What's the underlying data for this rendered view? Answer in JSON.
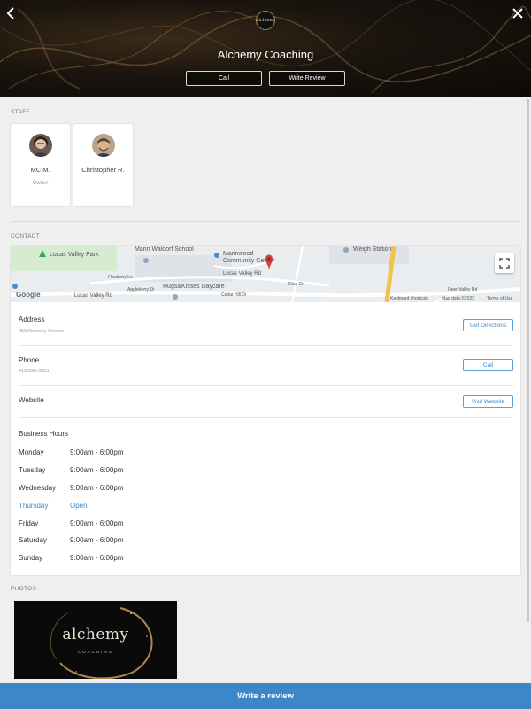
{
  "header": {
    "logo_text": "alchemy",
    "title": "Alchemy Coaching",
    "call_label": "Call",
    "review_label": "Write Review",
    "back_icon": "chevron-left-icon",
    "close_icon": "close-icon"
  },
  "staff": {
    "label": "STAFF",
    "members": [
      {
        "name": "MC M.",
        "role": "Owner"
      },
      {
        "name": "Christopher R.",
        "role": ""
      }
    ]
  },
  "contact": {
    "label": "CONTACT",
    "map": {
      "places": [
        "Lucas Valley Park",
        "Marin Waldorf School",
        "Marinwood Community Center",
        "Weigh Station",
        "Hugs&Kisses Daycare",
        "Lucas Valley Rd",
        "Lucas Valley Rd",
        "Flaxberry Ln",
        "Appleberry Dr",
        "Cedar Hill Dr",
        "Ellen Dr",
        "Deer Valley Rd"
      ],
      "attribution": [
        "Google",
        "Keyboard shortcuts",
        "Map data ©2022",
        "Terms of Use"
      ]
    },
    "address": {
      "title": "Address",
      "value": "950 Alchemy Avenue",
      "button": "Get Directions"
    },
    "phone": {
      "title": "Phone",
      "value": "413-896-3983",
      "button": "Call"
    },
    "website": {
      "title": "Website",
      "button": "Visit Website"
    },
    "hours": {
      "title": "Business Hours",
      "days": [
        {
          "day": "Monday",
          "time": "9:00am - 6:00pm"
        },
        {
          "day": "Tuesday",
          "time": "9:00am - 6:00pm"
        },
        {
          "day": "Wednesday",
          "time": "9:00am - 6:00pm"
        },
        {
          "day": "Thursday",
          "time": "Open"
        },
        {
          "day": "Friday",
          "time": "9:00am - 6:00pm"
        },
        {
          "day": "Saturday",
          "time": "9:00am - 6:00pm"
        },
        {
          "day": "Sunday",
          "time": "9:00am - 6:00pm"
        }
      ]
    }
  },
  "photos": {
    "label": "PHOTOS",
    "items": [
      {
        "word": "alchemy",
        "sub": "COACHING"
      }
    ]
  },
  "footer": {
    "write_review": "Write a review"
  },
  "colors": {
    "accent": "#3b87c8",
    "hero_bg": "#0b0907",
    "today": "#3b87c8"
  }
}
